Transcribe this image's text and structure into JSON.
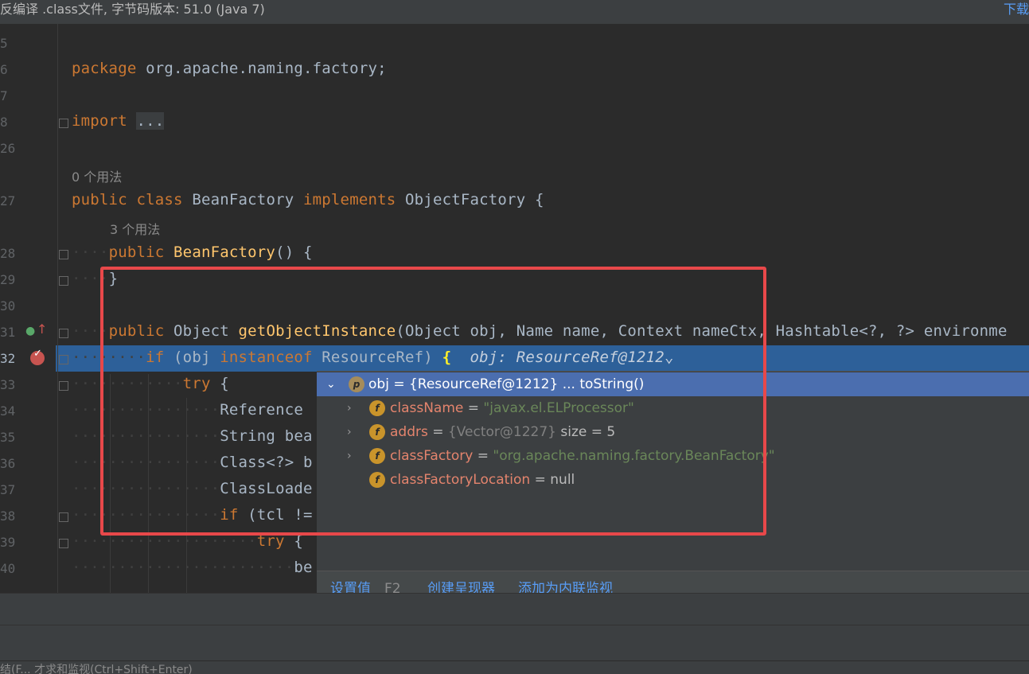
{
  "banner": {
    "left_text": "反编译 .class文件, 字节码版本: 51.0 (Java 7)",
    "right_text": "下载"
  },
  "gutter": {
    "line_numbers": [
      "5",
      "6",
      "7",
      "8",
      "26",
      "27",
      "28",
      "29",
      "30",
      "31",
      "32",
      "33",
      "34",
      "35",
      "36",
      "37",
      "38",
      "39",
      "40"
    ]
  },
  "code": {
    "package_kw": "package",
    "package_name": "org.apache.naming.factory;",
    "import_kw": "import",
    "import_collapsed": "...",
    "usages_class": "0 个用法",
    "line27": {
      "public": "public",
      "class": "class",
      "name": "BeanFactory",
      "implements": "implements",
      "iface": "ObjectFactory",
      "brace": "{"
    },
    "usages_ctor": "3 个用法",
    "line28": {
      "public": "public",
      "name": "BeanFactory",
      "rest": "() {"
    },
    "line29": "}",
    "line31": {
      "public": "public",
      "type": "Object",
      "name": "getObjectInstance",
      "params": "(Object obj, Name name, Context nameCtx, Hashtable<?, ?> environme"
    },
    "line32": {
      "if": "if",
      "pre": " (obj ",
      "instanceof": "instanceof",
      "post": " ResourceRef) ",
      "brace": "{",
      "inline_hint": "obj: ResourceRef@1212",
      "chevron": "⌄"
    },
    "line33": {
      "try": "try",
      "rest": " {"
    },
    "line34": "Reference ",
    "line35": "String bea",
    "line36": "Class<?> b",
    "line37": "ClassLoade",
    "line38": {
      "if": "if",
      "rest": " (tcl !="
    },
    "line39": {
      "try": "try",
      "rest": " {"
    },
    "line40": "be"
  },
  "debug_popup": {
    "root": {
      "badge": "p",
      "text": "obj = {ResourceRef@1212} ... toString()"
    },
    "fields": [
      {
        "badge": "f",
        "name": "className",
        "eq": " = ",
        "value": "\"javax.el.ELProcessor\"",
        "extra": "",
        "expandable": true
      },
      {
        "badge": "f",
        "name": "addrs",
        "eq": " = ",
        "value": "{Vector@1227}",
        "extra": " size = 5",
        "expandable": true
      },
      {
        "badge": "f",
        "name": "classFactory",
        "eq": " = ",
        "value": "\"org.apache.naming.factory.BeanFactory\"",
        "extra": "",
        "expandable": true
      },
      {
        "badge": "f",
        "name": "classFactoryLocation",
        "eq": " = ",
        "value": "null",
        "extra": "",
        "expandable": false
      }
    ],
    "footer": {
      "set_value": "设置值",
      "set_value_shortcut": "F2",
      "create_renderer": "创建呈现器",
      "add_inline_watch": "添加为内联监视"
    }
  },
  "status": {
    "bottom_text": "结(F...  才求和监视(Ctrl+Shift+Enter)"
  },
  "colors": {
    "editor_bg": "#2b2b2b",
    "keyword": "#cc7832",
    "function": "#ffc66d",
    "highlight_line": "#2d6099",
    "annotation_box": "#e8484a",
    "selected_row": "#4b6eaf"
  }
}
